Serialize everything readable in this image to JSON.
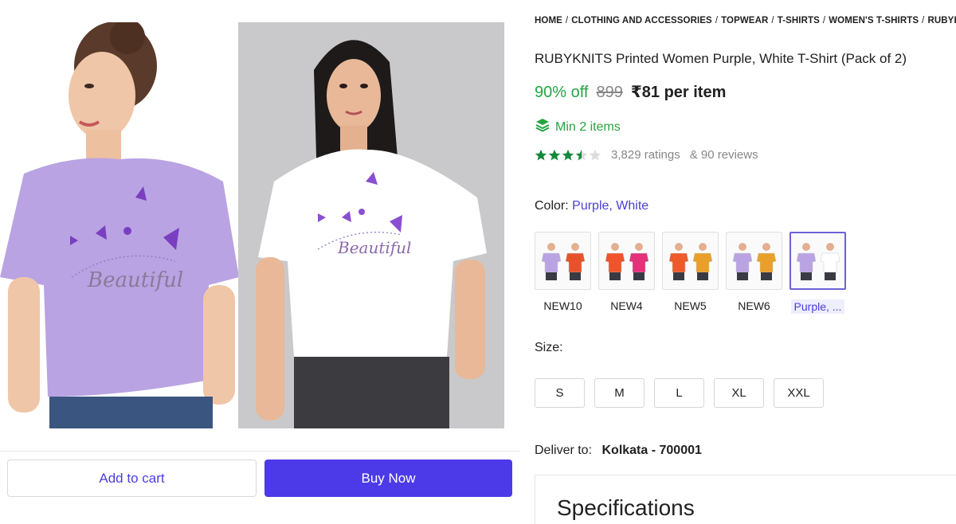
{
  "breadcrumb": [
    "HOME",
    "CLOTHING AND ACCESSORIES",
    "TOPWEAR",
    "T-SHIRTS",
    "WOMEN'S T-SHIRTS",
    "RUBYKNITS"
  ],
  "product": {
    "title": "RUBYKNITS Printed Women Purple, White T-Shirt (Pack of 2)",
    "discount": "90% off",
    "mrp": "899",
    "price": "₹81 per item",
    "min_items": "Min 2 items",
    "rating_value": 3.5,
    "ratings_text": "3,829 ratings",
    "reviews_text": "& 90 reviews"
  },
  "gallery": {
    "left_print_text": "Beautiful",
    "right_print_text": "Beautiful"
  },
  "color": {
    "label": "Color:",
    "value": "Purple, White",
    "options": [
      {
        "label": "NEW10",
        "colors": [
          "#b9a3e3",
          "#e8522b"
        ]
      },
      {
        "label": "NEW4",
        "colors": [
          "#f0542a",
          "#e3317a"
        ]
      },
      {
        "label": "NEW5",
        "colors": [
          "#ee5a2a",
          "#e8a02a"
        ]
      },
      {
        "label": "NEW6",
        "colors": [
          "#b9a3e3",
          "#e8a02a"
        ]
      },
      {
        "label": "Purple, ...",
        "colors": [
          "#b9a3e3",
          "#ffffff"
        ],
        "selected": true
      }
    ]
  },
  "size": {
    "label": "Size:",
    "options": [
      "S",
      "M",
      "L",
      "XL",
      "XXL"
    ]
  },
  "delivery": {
    "label": "Deliver to:",
    "place": "Kolkata - 700001"
  },
  "specifications_title": "Specifications",
  "actions": {
    "add_to_cart": "Add to cart",
    "buy_now": "Buy Now"
  },
  "colors": {
    "accent": "#4c3ae8",
    "green": "#26a541",
    "purple_shirt": "#b9a3e3"
  }
}
